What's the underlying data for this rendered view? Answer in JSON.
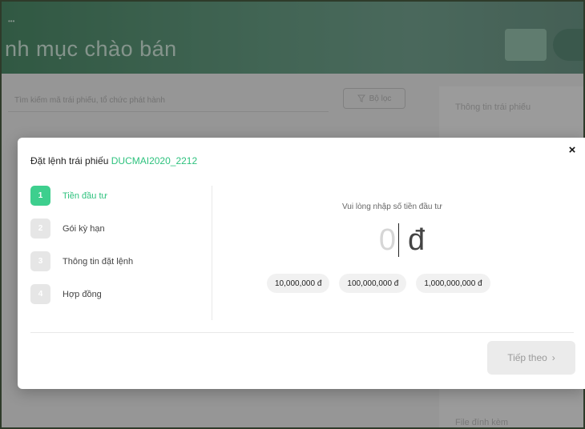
{
  "background": {
    "hero_tag": "•••",
    "hero_title": "nh mục chào bán",
    "search_placeholder": "Tìm kiếm mã trái phiếu, tổ chức phát hành",
    "filter_label": "Bộ lọc",
    "right_panel_title": "Thông tin trái phiếu",
    "right_panel_attachment": "File đính kèm"
  },
  "modal": {
    "title_prefix": "Đặt lệnh trái phiếu",
    "bond_code": "DUCMAI2020_2212",
    "close_symbol": "×",
    "steps": [
      {
        "number": "1",
        "label": "Tiền đầu tư",
        "active": true
      },
      {
        "number": "2",
        "label": "Gói kỳ hạn",
        "active": false
      },
      {
        "number": "3",
        "label": "Thông tin đặt lệnh",
        "active": false
      },
      {
        "number": "4",
        "label": "Hợp đồng",
        "active": false
      }
    ],
    "amount_prompt": "Vui lòng nhập số tiền đầu tư",
    "amount_value": "0",
    "currency_symbol": "đ",
    "quick_amounts": [
      "10,000,000 đ",
      "100,000,000 đ",
      "1,000,000,000 đ"
    ],
    "next_button_label": "Tiếp theo",
    "next_button_icon": "›"
  },
  "colors": {
    "accent": "#3ecf8e",
    "accent_text": "#2ec27e"
  }
}
